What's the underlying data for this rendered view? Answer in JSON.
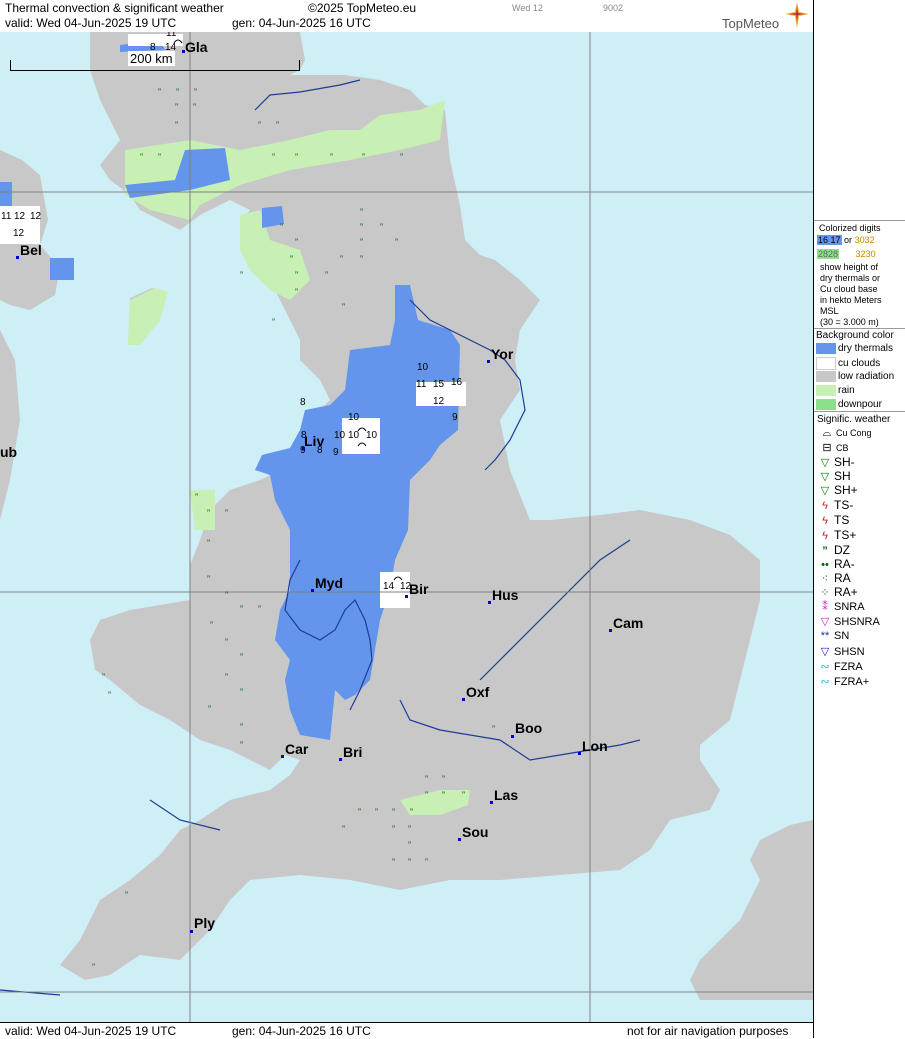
{
  "header": {
    "title": "Thermal convection & significant weather",
    "copyright": "©2025 TopMeteo.eu",
    "day_code": "Wed 12",
    "code": "9002",
    "valid": "valid:  Wed  04-Jun-2025  19 UTC",
    "generated": "gen: 04-Jun-2025 16 UTC",
    "brand": "TopMeteo"
  },
  "footer": {
    "valid": "valid:  Wed  04-Jun-2025  19 UTC",
    "generated": "gen: 04-Jun-2025 16 UTC",
    "disclaimer": "not for air navigation purposes"
  },
  "map": {
    "scale_label": "200 km",
    "cities": [
      {
        "name": "Gla"
      },
      {
        "name": "Bel"
      },
      {
        "name": "ub"
      },
      {
        "name": "Yor"
      },
      {
        "name": "Liv"
      },
      {
        "name": "Myd"
      },
      {
        "name": "Bir"
      },
      {
        "name": "Hus"
      },
      {
        "name": "Cam"
      },
      {
        "name": "Oxf"
      },
      {
        "name": "Boo"
      },
      {
        "name": "Lon"
      },
      {
        "name": "Car"
      },
      {
        "name": "Bri"
      },
      {
        "name": "Las"
      },
      {
        "name": "Sou"
      },
      {
        "name": "Ply"
      }
    ],
    "digits": [
      "10",
      "11",
      "15",
      "16",
      "12",
      "9",
      "10",
      "10",
      "10",
      "8",
      "10",
      "9",
      "9",
      "8",
      "8",
      "14",
      "12",
      "11",
      "12",
      "12",
      "12",
      "14",
      "8",
      "11"
    ],
    "colors": {
      "sea": "#cfeff7",
      "land": "#c8c8c8",
      "dry_thermals": "#6495ed",
      "cu_clouds": "#ffffff",
      "rain": "#c8f0b4",
      "downpour": "#8ce08c",
      "river": "#1e3c96"
    }
  },
  "legend": {
    "colorized_title": "Colorized digits",
    "sample_blue": "16  17",
    "or": "or",
    "sample_orange1": "3032",
    "sample_green": "2828",
    "sample_orange2": "3230",
    "desc1": "show height of",
    "desc2": "dry thermals or",
    "desc3": "Cu cloud base",
    "desc4": "in hekto Meters",
    "desc5": "MSL",
    "desc6": "(30 = 3.000 m)",
    "bg_title": "Background color",
    "bg_items": [
      "dry thermals",
      "cu clouds",
      "low radiation",
      "rain",
      "downpour"
    ],
    "sig_title": "Signific. weather",
    "sig_items": [
      "Cu Cong",
      "CB",
      "SH-",
      "SH",
      "SH+",
      "TS-",
      "TS",
      "TS+",
      "DZ",
      "RA-",
      "RA",
      "RA+",
      "SNRA",
      "SHSNRA",
      "SN",
      "SHSN",
      "FZRA",
      "FZRA+"
    ]
  }
}
